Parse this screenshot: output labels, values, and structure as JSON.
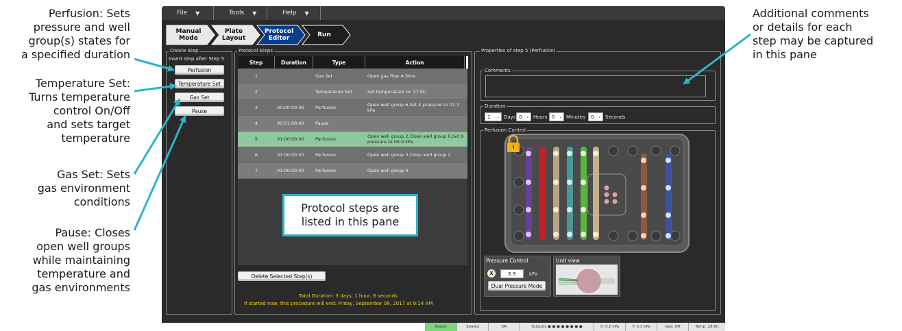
{
  "annotations": {
    "perfusion": "Perfusion: Sets\npressure and well\ngroup(s) states for\na specified duration",
    "temperature": "Temperature Set:\nTurns temperature\ncontrol On/Off\nand sets target\ntemperature",
    "gas": "Gas Set: Sets\ngas environment\nconditions",
    "pause": "Pause: Closes\nopen well groups\nwhile maintaining\ntemperature and\ngas environments",
    "comments": "Additional comments\nor details for each\nstep may be captured\nin this pane",
    "protocol_pane": "Protocol steps are\nlisted in this pane"
  },
  "menu": {
    "file": "File",
    "tools": "Tools",
    "help": "Help",
    "caret": "▼"
  },
  "workflow": [
    "Manual\nMode",
    "Plate\nLayout",
    "Protocol\nEditor",
    "Run"
  ],
  "create_step": {
    "title": "Create Step",
    "subtitle": "Insert step after Step 5",
    "buttons": [
      "Perfusion",
      "Temperature Set",
      "Gas Set",
      "Pause"
    ]
  },
  "protocol_steps": {
    "title": "Protocol Steps",
    "headers": [
      "Step",
      "Duration",
      "Type",
      "Action"
    ],
    "rows": [
      {
        "step": "1",
        "duration": "",
        "type": "Gas Set",
        "action": "Open gas flow A Slow"
      },
      {
        "step": "2",
        "duration": "",
        "type": "Temperature Set",
        "action": "Set temperature to: 37.0C"
      },
      {
        "step": "3",
        "duration": "00:00:00:06",
        "type": "Perfusion",
        "action": "Open well group 6,Set X pressure to 01.7 kPa"
      },
      {
        "step": "4",
        "duration": "00:01:00:00",
        "type": "Pause",
        "action": ""
      },
      {
        "step": "5",
        "duration": "01:00:00:00",
        "type": "Perfusion",
        "action": "Open well group 2,Close well group 6,Set X pressure to 06.9 kPa"
      },
      {
        "step": "6",
        "duration": "01:00:00:00",
        "type": "Perfusion",
        "action": "Open well group 3,Close well group 2"
      },
      {
        "step": "7",
        "duration": "01:00:00:00",
        "type": "Perfusion",
        "action": "Open well group 4"
      }
    ],
    "selected_index": 4,
    "delete_button": "Delete Selected Step(s)",
    "total_duration": "Total Duration: 3 days, 1 hour, 6 seconds",
    "end_time": "If started now, this procedure will end: Friday, September 08, 2017 at 9:14 AM"
  },
  "properties": {
    "title": "Properties of step 5 (Perfusion)",
    "comments_label": "Comments",
    "comments_value": "",
    "duration_label": "Duration",
    "duration": [
      {
        "value": "1",
        "unit": "Days"
      },
      {
        "value": "0",
        "unit": "Hours"
      },
      {
        "value": "0",
        "unit": "Minutes"
      },
      {
        "value": "0",
        "unit": "Seconds"
      }
    ],
    "perfusion_control_label": "Perfusion Control",
    "pressure_control_label": "Pressure Control",
    "pressure_channel": "X",
    "pressure_value": "6.9",
    "pressure_unit": "kPa",
    "dual_pressure_button": "Dual Pressure Mode",
    "unit_view_label": "Unit view"
  },
  "status_bar": [
    "Ready",
    "Sealed",
    "OK",
    "Outputs ● ● ● ● ● ● ● ●",
    "X: 0.0 kPa",
    "Y: 0.1 kPa",
    "Gas: Off",
    "Temp: 28.6C"
  ],
  "colors": {
    "accent_cyan": "#2cb6c6",
    "selected_row": "#8ec89c",
    "ready_green": "#7fd47f",
    "summary_yellow": "#f2d21c",
    "workflow_active": "#0a3d8c"
  }
}
